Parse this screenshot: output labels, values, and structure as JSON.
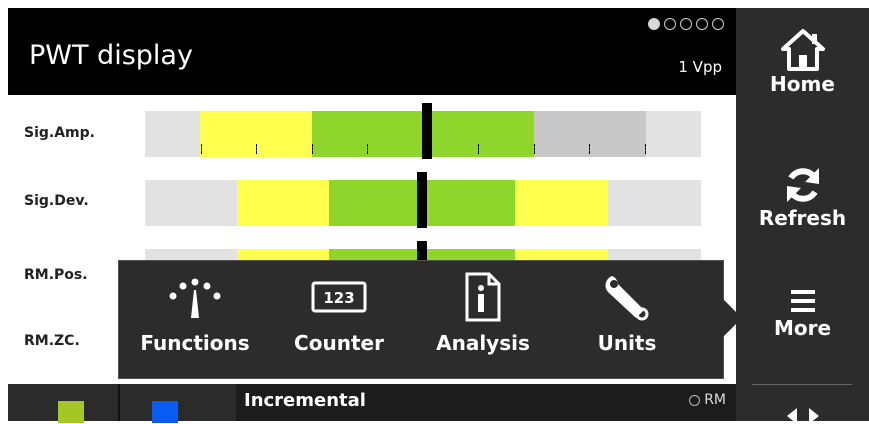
{
  "header": {
    "title": "PWT display",
    "signal_type": "1 Vpp",
    "page_indicator": {
      "total": 5,
      "active": 1
    }
  },
  "rows": [
    {
      "label": "Sig.Amp."
    },
    {
      "label": "Sig.Dev."
    },
    {
      "label": "RM.Pos."
    },
    {
      "label": "RM.ZC."
    }
  ],
  "menu": {
    "items": [
      {
        "label": "Functions",
        "icon": "gauge-icon"
      },
      {
        "label": "Counter",
        "icon": "counter-123-icon",
        "icon_text": "123"
      },
      {
        "label": "Analysis",
        "icon": "info-document-icon"
      },
      {
        "label": "Units",
        "icon": "wrench-icon"
      }
    ]
  },
  "sidebar": {
    "home_label": "Home",
    "refresh_label": "Refresh",
    "more_label": "More"
  },
  "bottom": {
    "mode_label": "Incremental",
    "rm_label": "RM"
  },
  "colors": {
    "yellow": "#ffff4d",
    "green": "#8ed62c",
    "gray_bar": "#e2e2e2",
    "dark_panel": "#2c2c2c",
    "swatch_green": "#a4c626",
    "swatch_blue": "#0a5cf5"
  }
}
